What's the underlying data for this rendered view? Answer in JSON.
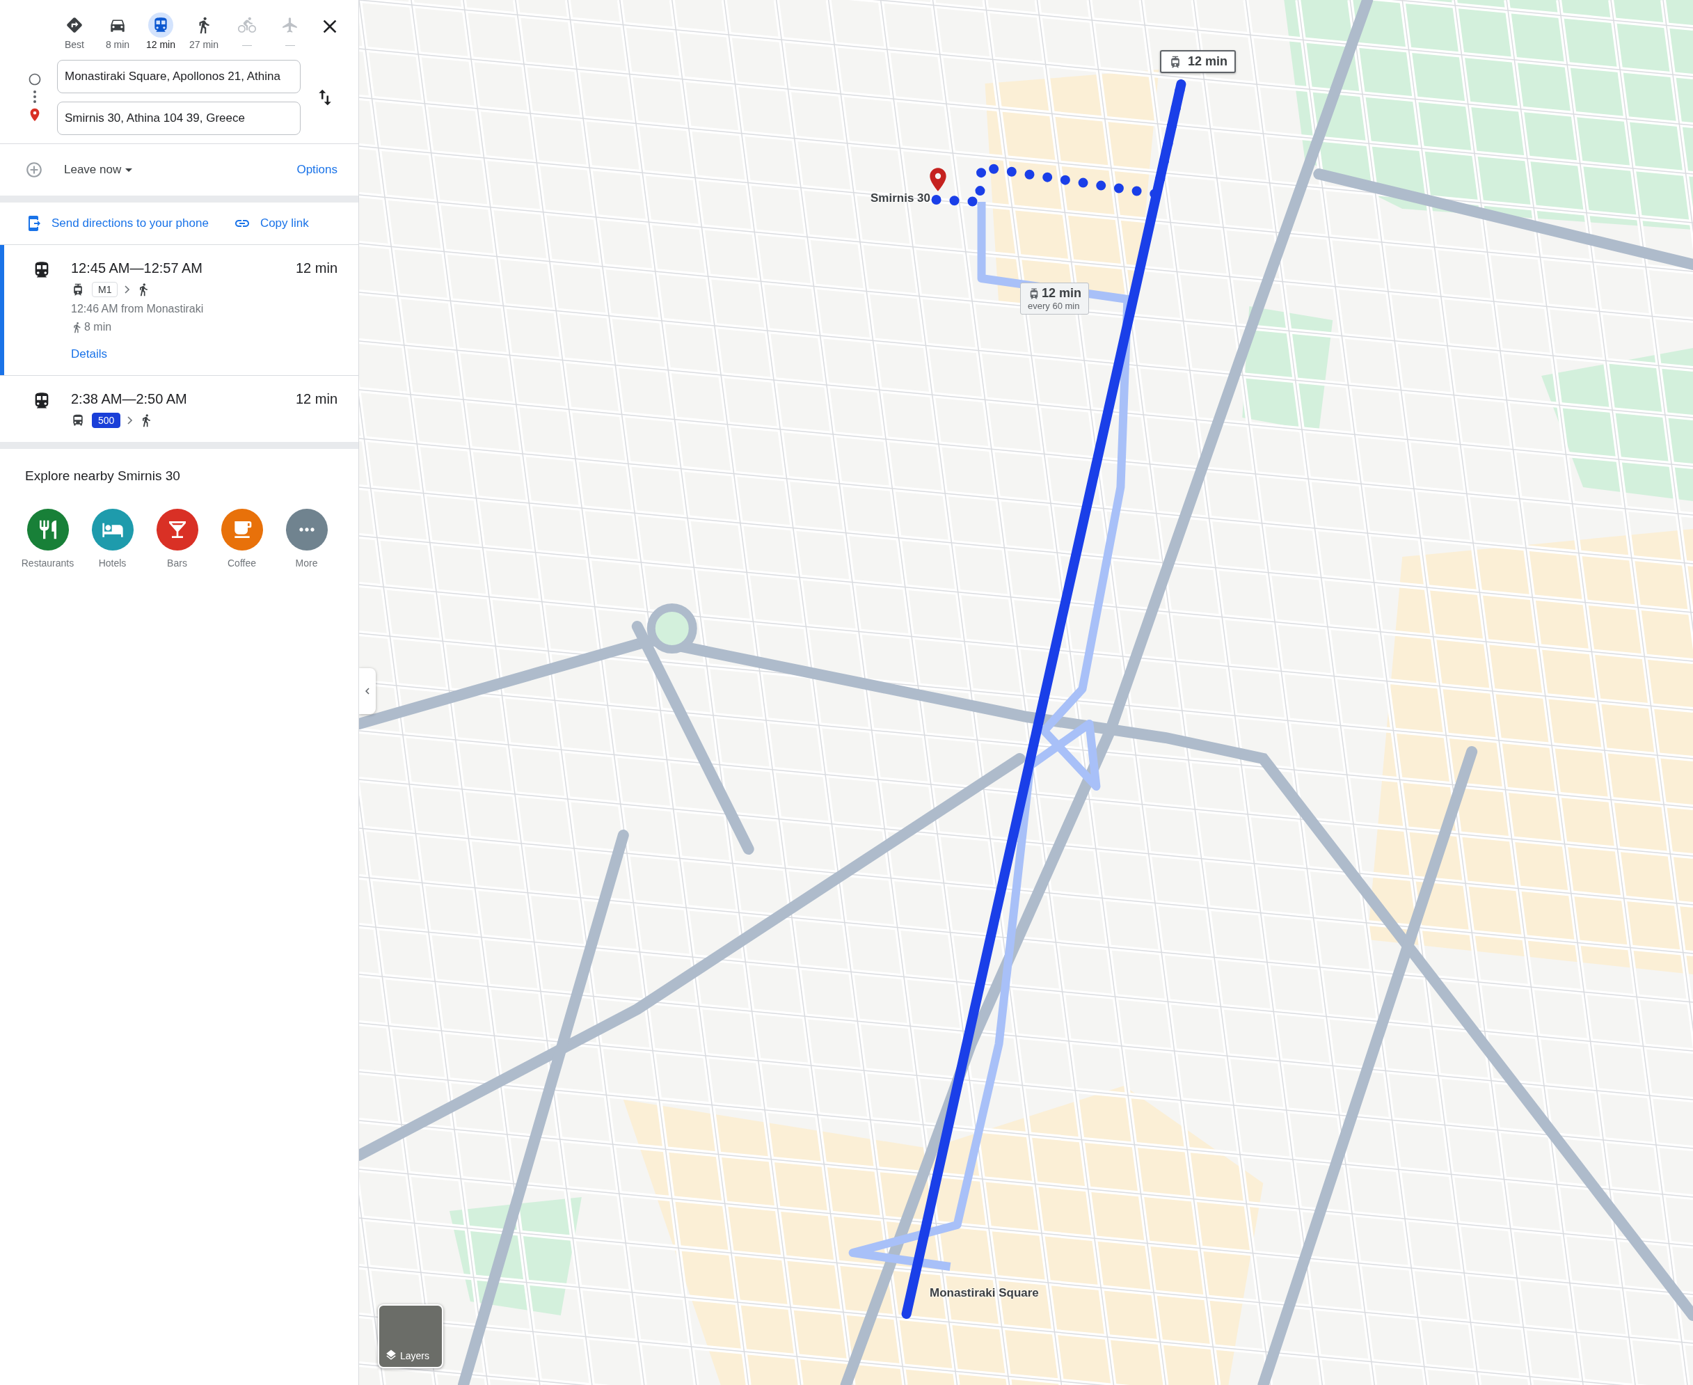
{
  "travel_modes": [
    {
      "kind": "best",
      "label": "Best",
      "selected": false,
      "disabled": false
    },
    {
      "kind": "car",
      "label": "8 min",
      "selected": false,
      "disabled": false
    },
    {
      "kind": "transit",
      "label": "12 min",
      "selected": true,
      "disabled": false
    },
    {
      "kind": "walk",
      "label": "27 min",
      "selected": false,
      "disabled": false
    },
    {
      "kind": "bike",
      "label": "—",
      "selected": false,
      "disabled": true
    },
    {
      "kind": "flight",
      "label": "—",
      "selected": false,
      "disabled": true
    }
  ],
  "origin": {
    "value": "Monastiraki Square, Apollonos 21, Athina"
  },
  "destination": {
    "value": "Smirnis 30, Athina 104 39, Greece"
  },
  "departure": {
    "label": "Leave now",
    "options": "Options"
  },
  "share": {
    "send": "Send directions to your phone",
    "copy": "Copy link"
  },
  "routes": [
    {
      "time": "12:45 AM—12:57 AM",
      "duration": "12 min",
      "selected": true,
      "steps": [
        {
          "kind": "metro",
          "line": "M1",
          "color": "#ffffff"
        },
        {
          "kind": "walk"
        }
      ],
      "departure": "12:46 AM from Monastiraki",
      "walk": "8 min",
      "details": "Details"
    },
    {
      "time": "2:38 AM—2:50 AM",
      "duration": "12 min",
      "selected": false,
      "steps": [
        {
          "kind": "bus",
          "line": "500",
          "color": "#1a3fd8"
        },
        {
          "kind": "walk"
        }
      ]
    }
  ],
  "explore": {
    "title": "Explore nearby Smirnis 30",
    "categories": [
      {
        "kind": "restaurants",
        "label": "Restaurants",
        "color": "#188038"
      },
      {
        "kind": "hotels",
        "label": "Hotels",
        "color": "#1e9bac"
      },
      {
        "kind": "bars",
        "label": "Bars",
        "color": "#d93025"
      },
      {
        "kind": "coffee",
        "label": "Coffee",
        "color": "#e8710a"
      },
      {
        "kind": "more",
        "label": "More",
        "color": "#70838f"
      }
    ]
  },
  "map": {
    "route_callouts": [
      {
        "kind": "primary",
        "duration": "12 min"
      },
      {
        "kind": "alternate",
        "duration": "12 min",
        "frequency": "every 60 min"
      }
    ],
    "destination_label": "Smirnis 30",
    "origin_label": "Monastiraki Square",
    "layers": "Layers"
  }
}
